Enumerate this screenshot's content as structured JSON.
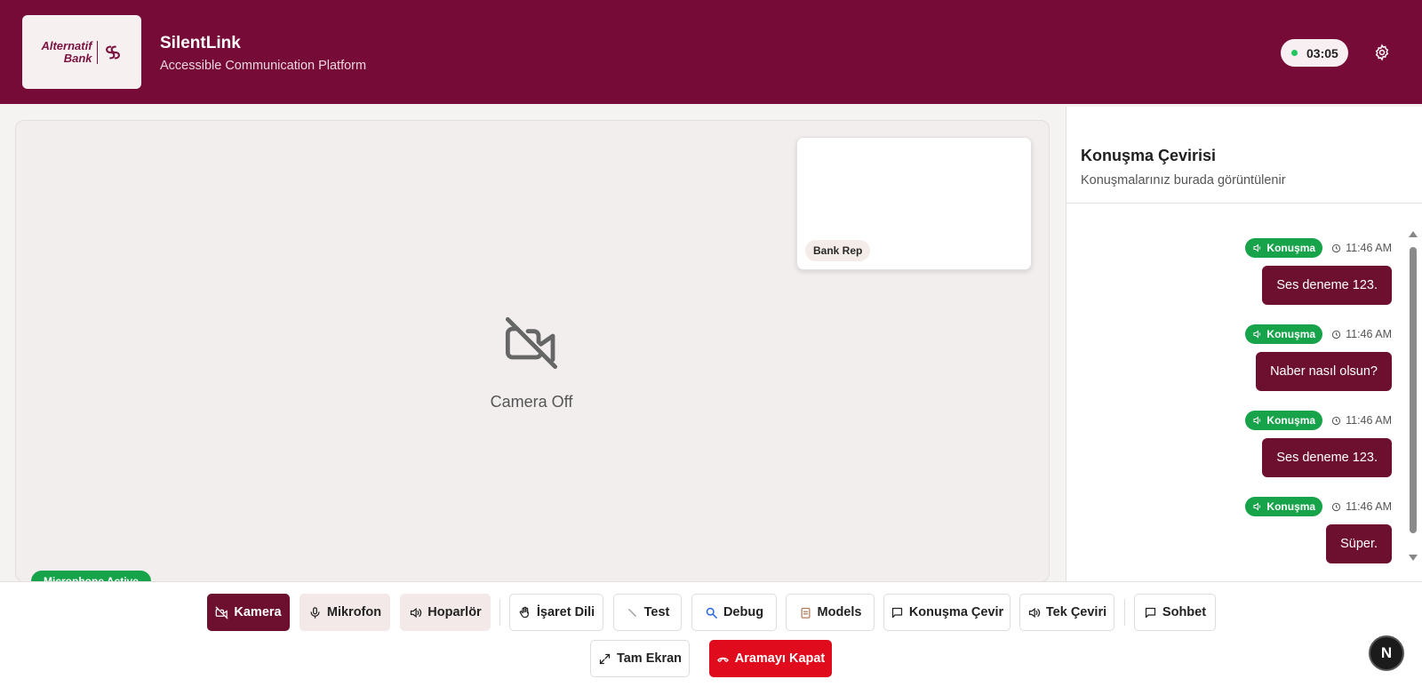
{
  "header": {
    "logo_line1": "Alternatif",
    "logo_line2": "Bank",
    "title": "SilentLink",
    "subtitle": "Accessible Communication Platform",
    "timer": "03:05",
    "colors": {
      "brand": "#770b38",
      "status_dot": "#22c55e"
    }
  },
  "video": {
    "pip_label": "Bank Rep",
    "camera_off_text": "Camera Off",
    "mic_badge": "Microphone Active"
  },
  "chat": {
    "title": "Konuşma Çevirisi",
    "subtitle": "Konuşmalarınız burada görüntülenir",
    "messages": [
      {
        "tag": "Konuşma",
        "time": "11:46 AM",
        "text": "Ses deneme 123."
      },
      {
        "tag": "Konuşma",
        "time": "11:46 AM",
        "text": "Naber nasıl olsun?"
      },
      {
        "tag": "Konuşma",
        "time": "11:46 AM",
        "text": "Ses deneme 123."
      },
      {
        "tag": "Konuşma",
        "time": "11:46 AM",
        "text": "Süper."
      }
    ]
  },
  "toolbar": {
    "camera": "Kamera",
    "microphone": "Mikrofon",
    "speaker": "Hoparlör",
    "sign_language": "İşaret Dili",
    "test": "Test",
    "debug": "Debug",
    "models": "Models",
    "speech_translate": "Konuşma Çevir",
    "single_translate": "Tek Çeviri",
    "chat": "Sohbet",
    "fullscreen": "Tam Ekran",
    "end_call": "Aramayı Kapat"
  },
  "corner_avatar": "N"
}
